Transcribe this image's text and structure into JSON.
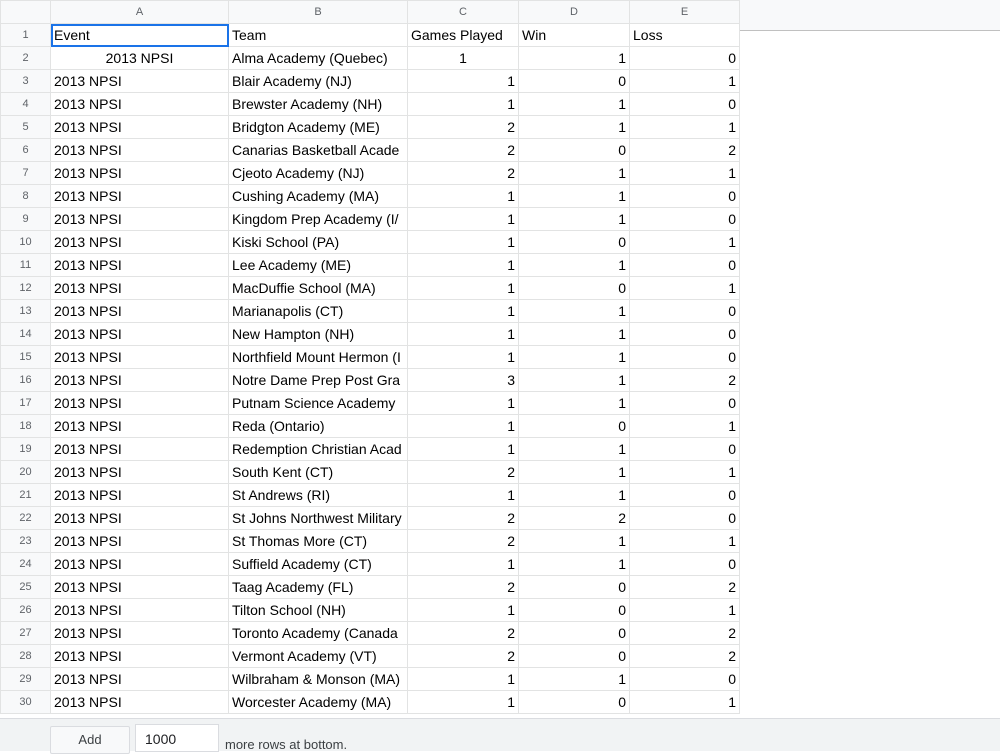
{
  "columns": [
    "A",
    "B",
    "C",
    "D",
    "E"
  ],
  "rows": [
    {
      "n": "1",
      "a": "Event",
      "b": "Team",
      "c": "Games Played",
      "d": "Win",
      "e": "Loss"
    },
    {
      "n": "2",
      "a": "2013 NPSI",
      "b": "Alma Academy (Quebec)",
      "c": "1",
      "d": "1",
      "e": "0"
    },
    {
      "n": "3",
      "a": "2013 NPSI",
      "b": "Blair Academy (NJ)",
      "c": "1",
      "d": "0",
      "e": "1"
    },
    {
      "n": "4",
      "a": "2013 NPSI",
      "b": "Brewster Academy (NH)",
      "c": "1",
      "d": "1",
      "e": "0"
    },
    {
      "n": "5",
      "a": "2013 NPSI",
      "b": "Bridgton Academy (ME)",
      "c": "2",
      "d": "1",
      "e": "1"
    },
    {
      "n": "6",
      "a": "2013 NPSI",
      "b": "Canarias Basketball Acade",
      "c": "2",
      "d": "0",
      "e": "2"
    },
    {
      "n": "7",
      "a": "2013 NPSI",
      "b": "Cjeoto Academy (NJ)",
      "c": "2",
      "d": "1",
      "e": "1"
    },
    {
      "n": "8",
      "a": "2013 NPSI",
      "b": "Cushing Academy (MA)",
      "c": "1",
      "d": "1",
      "e": "0"
    },
    {
      "n": "9",
      "a": "2013 NPSI",
      "b": "Kingdom Prep Academy (I/",
      "c": "1",
      "d": "1",
      "e": "0"
    },
    {
      "n": "10",
      "a": "2013 NPSI",
      "b": "Kiski School (PA)",
      "c": "1",
      "d": "0",
      "e": "1"
    },
    {
      "n": "11",
      "a": "2013 NPSI",
      "b": "Lee Academy (ME)",
      "c": "1",
      "d": "1",
      "e": "0"
    },
    {
      "n": "12",
      "a": "2013 NPSI",
      "b": "MacDuffie School (MA)",
      "c": "1",
      "d": "0",
      "e": "1"
    },
    {
      "n": "13",
      "a": "2013 NPSI",
      "b": "Marianapolis (CT)",
      "c": "1",
      "d": "1",
      "e": "0"
    },
    {
      "n": "14",
      "a": "2013 NPSI",
      "b": "New Hampton (NH)",
      "c": "1",
      "d": "1",
      "e": "0"
    },
    {
      "n": "15",
      "a": "2013 NPSI",
      "b": "Northfield Mount Hermon (I",
      "c": "1",
      "d": "1",
      "e": "0"
    },
    {
      "n": "16",
      "a": "2013 NPSI",
      "b": "Notre Dame Prep Post Gra",
      "c": "3",
      "d": "1",
      "e": "2"
    },
    {
      "n": "17",
      "a": "2013 NPSI",
      "b": "Putnam Science Academy",
      "c": "1",
      "d": "1",
      "e": "0"
    },
    {
      "n": "18",
      "a": "2013 NPSI",
      "b": "Reda (Ontario)",
      "c": "1",
      "d": "0",
      "e": "1"
    },
    {
      "n": "19",
      "a": "2013 NPSI",
      "b": "Redemption Christian Acad",
      "c": "1",
      "d": "1",
      "e": "0"
    },
    {
      "n": "20",
      "a": "2013 NPSI",
      "b": "South Kent (CT)",
      "c": "2",
      "d": "1",
      "e": "1"
    },
    {
      "n": "21",
      "a": "2013 NPSI",
      "b": "St Andrews (RI)",
      "c": "1",
      "d": "1",
      "e": "0"
    },
    {
      "n": "22",
      "a": "2013 NPSI",
      "b": "St Johns Northwest Military",
      "c": "2",
      "d": "2",
      "e": "0"
    },
    {
      "n": "23",
      "a": "2013 NPSI",
      "b": "St Thomas More (CT)",
      "c": "2",
      "d": "1",
      "e": "1"
    },
    {
      "n": "24",
      "a": "2013 NPSI",
      "b": "Suffield Academy (CT)",
      "c": "1",
      "d": "1",
      "e": "0"
    },
    {
      "n": "25",
      "a": "2013 NPSI",
      "b": "Taag Academy (FL)",
      "c": "2",
      "d": "0",
      "e": "2"
    },
    {
      "n": "26",
      "a": "2013 NPSI",
      "b": "Tilton School (NH)",
      "c": "1",
      "d": "0",
      "e": "1"
    },
    {
      "n": "27",
      "a": "2013 NPSI",
      "b": "Toronto Academy (Canada",
      "c": "2",
      "d": "0",
      "e": "2"
    },
    {
      "n": "28",
      "a": "2013 NPSI",
      "b": "Vermont Academy (VT)",
      "c": "2",
      "d": "0",
      "e": "2"
    },
    {
      "n": "29",
      "a": "2013 NPSI",
      "b": "Wilbraham & Monson (MA)",
      "c": "1",
      "d": "1",
      "e": "0"
    },
    {
      "n": "30",
      "a": "2013 NPSI",
      "b": "Worcester Academy (MA)",
      "c": "1",
      "d": "0",
      "e": "1"
    }
  ],
  "footer": {
    "add_label": "Add",
    "rows_value": "1000",
    "more_text": "more rows at bottom."
  }
}
